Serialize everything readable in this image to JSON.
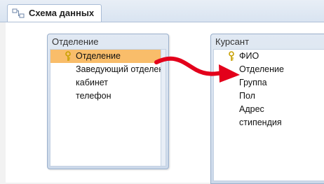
{
  "tab": {
    "label": "Схема данных",
    "icon": "relationships-icon"
  },
  "tables": [
    {
      "title": "Отделение",
      "fields": [
        {
          "name": "Отделение",
          "key": true,
          "selected": true
        },
        {
          "name": "Заведующий отделением",
          "key": false
        },
        {
          "name": "кабинет",
          "key": false
        },
        {
          "name": "телефон",
          "key": false
        }
      ]
    },
    {
      "title": "Курсант",
      "fields": [
        {
          "name": "ФИО",
          "key": true
        },
        {
          "name": "Отделение",
          "key": false
        },
        {
          "name": "Группа",
          "key": false
        },
        {
          "name": "Пол",
          "key": false
        },
        {
          "name": "Адрес",
          "key": false
        },
        {
          "name": "стипендия",
          "key": false
        }
      ]
    }
  ],
  "relationship_arrow": {
    "from": "Отделение.Отделение",
    "to": "Курсант.Отделение",
    "color": "#e3001b"
  },
  "colors": {
    "selected_row": "#f9bd6a",
    "key_icon": "#c8a000"
  }
}
